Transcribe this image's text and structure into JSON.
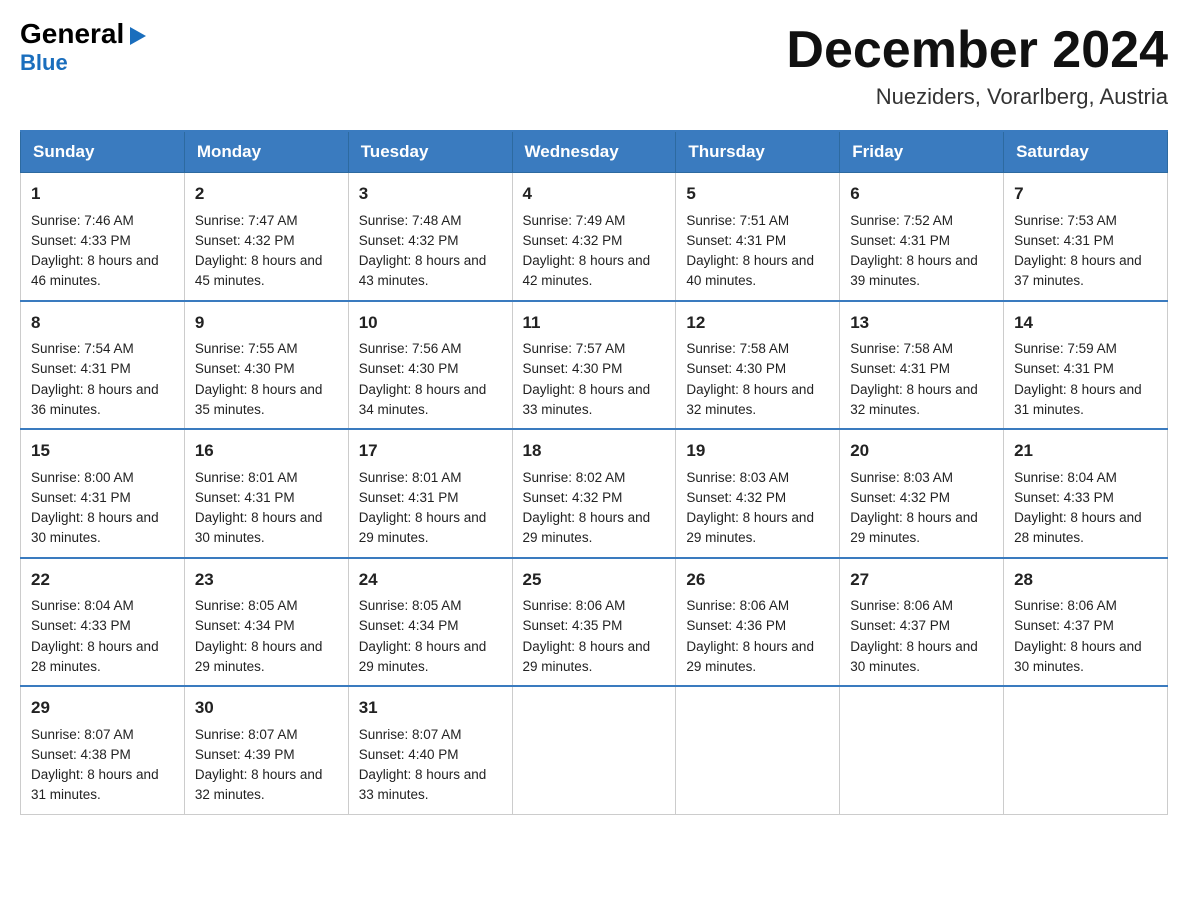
{
  "logo": {
    "general": "General",
    "arrow": "▶",
    "blue": "Blue"
  },
  "title": "December 2024",
  "location": "Nueziders, Vorarlberg, Austria",
  "days_of_week": [
    "Sunday",
    "Monday",
    "Tuesday",
    "Wednesday",
    "Thursday",
    "Friday",
    "Saturday"
  ],
  "weeks": [
    [
      {
        "day": "1",
        "sunrise": "Sunrise: 7:46 AM",
        "sunset": "Sunset: 4:33 PM",
        "daylight": "Daylight: 8 hours and 46 minutes."
      },
      {
        "day": "2",
        "sunrise": "Sunrise: 7:47 AM",
        "sunset": "Sunset: 4:32 PM",
        "daylight": "Daylight: 8 hours and 45 minutes."
      },
      {
        "day": "3",
        "sunrise": "Sunrise: 7:48 AM",
        "sunset": "Sunset: 4:32 PM",
        "daylight": "Daylight: 8 hours and 43 minutes."
      },
      {
        "day": "4",
        "sunrise": "Sunrise: 7:49 AM",
        "sunset": "Sunset: 4:32 PM",
        "daylight": "Daylight: 8 hours and 42 minutes."
      },
      {
        "day": "5",
        "sunrise": "Sunrise: 7:51 AM",
        "sunset": "Sunset: 4:31 PM",
        "daylight": "Daylight: 8 hours and 40 minutes."
      },
      {
        "day": "6",
        "sunrise": "Sunrise: 7:52 AM",
        "sunset": "Sunset: 4:31 PM",
        "daylight": "Daylight: 8 hours and 39 minutes."
      },
      {
        "day": "7",
        "sunrise": "Sunrise: 7:53 AM",
        "sunset": "Sunset: 4:31 PM",
        "daylight": "Daylight: 8 hours and 37 minutes."
      }
    ],
    [
      {
        "day": "8",
        "sunrise": "Sunrise: 7:54 AM",
        "sunset": "Sunset: 4:31 PM",
        "daylight": "Daylight: 8 hours and 36 minutes."
      },
      {
        "day": "9",
        "sunrise": "Sunrise: 7:55 AM",
        "sunset": "Sunset: 4:30 PM",
        "daylight": "Daylight: 8 hours and 35 minutes."
      },
      {
        "day": "10",
        "sunrise": "Sunrise: 7:56 AM",
        "sunset": "Sunset: 4:30 PM",
        "daylight": "Daylight: 8 hours and 34 minutes."
      },
      {
        "day": "11",
        "sunrise": "Sunrise: 7:57 AM",
        "sunset": "Sunset: 4:30 PM",
        "daylight": "Daylight: 8 hours and 33 minutes."
      },
      {
        "day": "12",
        "sunrise": "Sunrise: 7:58 AM",
        "sunset": "Sunset: 4:30 PM",
        "daylight": "Daylight: 8 hours and 32 minutes."
      },
      {
        "day": "13",
        "sunrise": "Sunrise: 7:58 AM",
        "sunset": "Sunset: 4:31 PM",
        "daylight": "Daylight: 8 hours and 32 minutes."
      },
      {
        "day": "14",
        "sunrise": "Sunrise: 7:59 AM",
        "sunset": "Sunset: 4:31 PM",
        "daylight": "Daylight: 8 hours and 31 minutes."
      }
    ],
    [
      {
        "day": "15",
        "sunrise": "Sunrise: 8:00 AM",
        "sunset": "Sunset: 4:31 PM",
        "daylight": "Daylight: 8 hours and 30 minutes."
      },
      {
        "day": "16",
        "sunrise": "Sunrise: 8:01 AM",
        "sunset": "Sunset: 4:31 PM",
        "daylight": "Daylight: 8 hours and 30 minutes."
      },
      {
        "day": "17",
        "sunrise": "Sunrise: 8:01 AM",
        "sunset": "Sunset: 4:31 PM",
        "daylight": "Daylight: 8 hours and 29 minutes."
      },
      {
        "day": "18",
        "sunrise": "Sunrise: 8:02 AM",
        "sunset": "Sunset: 4:32 PM",
        "daylight": "Daylight: 8 hours and 29 minutes."
      },
      {
        "day": "19",
        "sunrise": "Sunrise: 8:03 AM",
        "sunset": "Sunset: 4:32 PM",
        "daylight": "Daylight: 8 hours and 29 minutes."
      },
      {
        "day": "20",
        "sunrise": "Sunrise: 8:03 AM",
        "sunset": "Sunset: 4:32 PM",
        "daylight": "Daylight: 8 hours and 29 minutes."
      },
      {
        "day": "21",
        "sunrise": "Sunrise: 8:04 AM",
        "sunset": "Sunset: 4:33 PM",
        "daylight": "Daylight: 8 hours and 28 minutes."
      }
    ],
    [
      {
        "day": "22",
        "sunrise": "Sunrise: 8:04 AM",
        "sunset": "Sunset: 4:33 PM",
        "daylight": "Daylight: 8 hours and 28 minutes."
      },
      {
        "day": "23",
        "sunrise": "Sunrise: 8:05 AM",
        "sunset": "Sunset: 4:34 PM",
        "daylight": "Daylight: 8 hours and 29 minutes."
      },
      {
        "day": "24",
        "sunrise": "Sunrise: 8:05 AM",
        "sunset": "Sunset: 4:34 PM",
        "daylight": "Daylight: 8 hours and 29 minutes."
      },
      {
        "day": "25",
        "sunrise": "Sunrise: 8:06 AM",
        "sunset": "Sunset: 4:35 PM",
        "daylight": "Daylight: 8 hours and 29 minutes."
      },
      {
        "day": "26",
        "sunrise": "Sunrise: 8:06 AM",
        "sunset": "Sunset: 4:36 PM",
        "daylight": "Daylight: 8 hours and 29 minutes."
      },
      {
        "day": "27",
        "sunrise": "Sunrise: 8:06 AM",
        "sunset": "Sunset: 4:37 PM",
        "daylight": "Daylight: 8 hours and 30 minutes."
      },
      {
        "day": "28",
        "sunrise": "Sunrise: 8:06 AM",
        "sunset": "Sunset: 4:37 PM",
        "daylight": "Daylight: 8 hours and 30 minutes."
      }
    ],
    [
      {
        "day": "29",
        "sunrise": "Sunrise: 8:07 AM",
        "sunset": "Sunset: 4:38 PM",
        "daylight": "Daylight: 8 hours and 31 minutes."
      },
      {
        "day": "30",
        "sunrise": "Sunrise: 8:07 AM",
        "sunset": "Sunset: 4:39 PM",
        "daylight": "Daylight: 8 hours and 32 minutes."
      },
      {
        "day": "31",
        "sunrise": "Sunrise: 8:07 AM",
        "sunset": "Sunset: 4:40 PM",
        "daylight": "Daylight: 8 hours and 33 minutes."
      },
      null,
      null,
      null,
      null
    ]
  ]
}
